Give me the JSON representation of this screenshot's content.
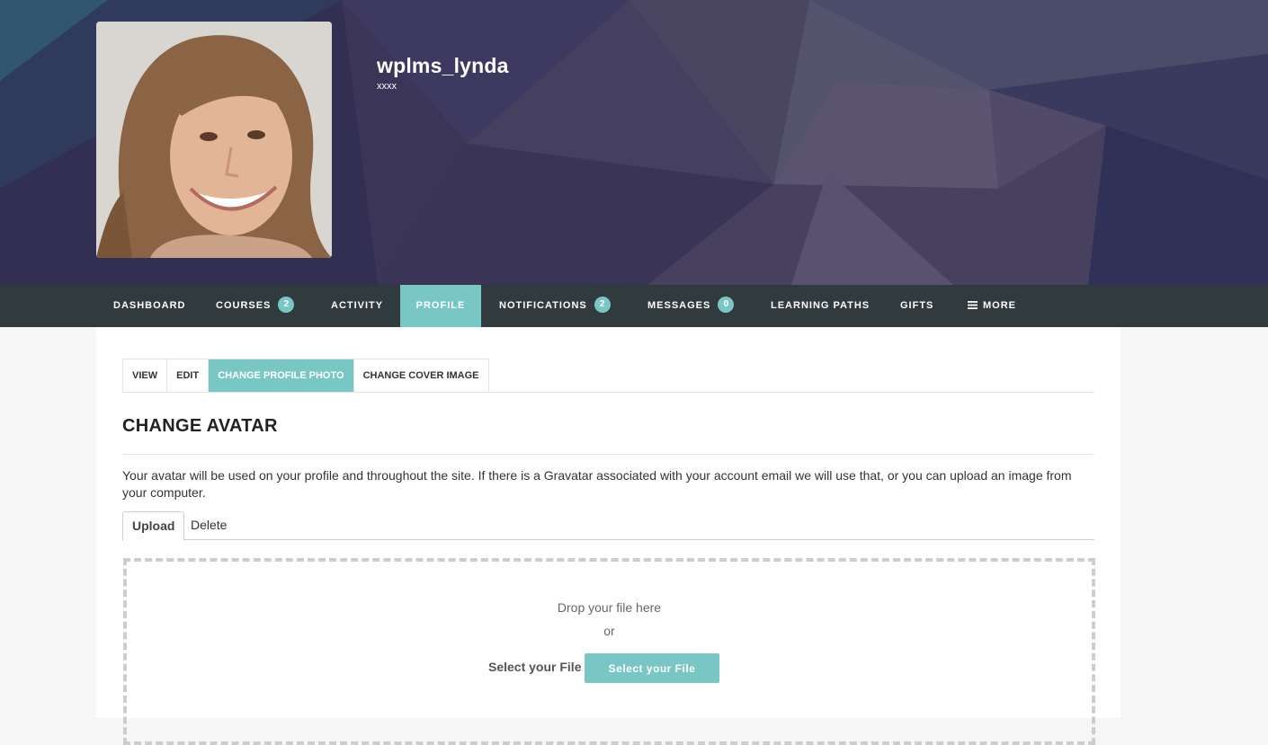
{
  "profile": {
    "name": "wplms_lynda",
    "handle": "xxxx"
  },
  "nav": {
    "items": [
      {
        "label": "DASHBOARD"
      },
      {
        "label": "COURSES",
        "badge": "2"
      },
      {
        "label": "ACTIVITY"
      },
      {
        "label": "PROFILE",
        "active": true
      },
      {
        "label": "NOTIFICATIONS",
        "badge": "2"
      },
      {
        "label": "MESSAGES",
        "badge": "0"
      },
      {
        "label": "LEARNING PATHS"
      },
      {
        "label": "GIFTS"
      },
      {
        "label": "MORE",
        "icon": "menu-icon"
      }
    ]
  },
  "subnav": {
    "items": [
      {
        "label": "VIEW"
      },
      {
        "label": "EDIT"
      },
      {
        "label": "CHANGE PROFILE PHOTO",
        "active": true
      },
      {
        "label": "CHANGE COVER IMAGE"
      }
    ]
  },
  "page": {
    "title": "CHANGE AVATAR",
    "description": "Your avatar will be used on your profile and throughout the site. If there is a Gravatar associated with your account email we will use that, or you can upload an image from your computer."
  },
  "avatar_tabs": {
    "upload": "Upload",
    "delete": "Delete"
  },
  "uploader": {
    "drop_text": "Drop your file here",
    "or_text": "or",
    "select_label": "Select your File",
    "select_button": "Select your File"
  },
  "colors": {
    "accent": "#79c7c5",
    "nav_bg": "#313b3d",
    "cover_bg": "#3a3557"
  }
}
